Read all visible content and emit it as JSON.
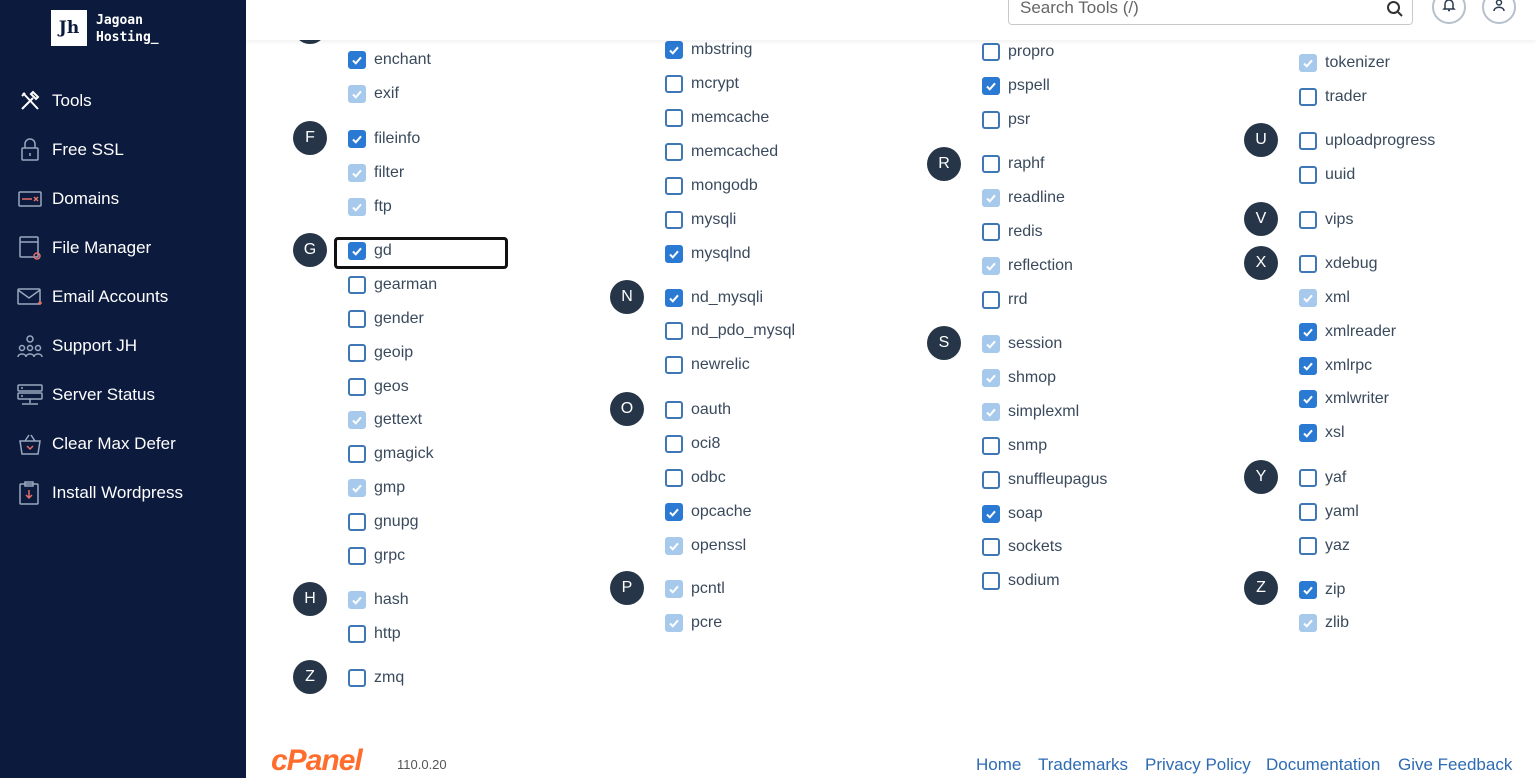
{
  "brand": {
    "logo_text": "Jh",
    "name_line1": "Jagoan",
    "name_line2": "Hosting_"
  },
  "sidebar": {
    "items": [
      {
        "label": "Tools",
        "icon": "tools-icon"
      },
      {
        "label": "Free SSL",
        "icon": "lock-icon"
      },
      {
        "label": "Domains",
        "icon": "domain-icon"
      },
      {
        "label": "File Manager",
        "icon": "file-manager-icon"
      },
      {
        "label": "Email Accounts",
        "icon": "email-icon"
      },
      {
        "label": "Support JH",
        "icon": "support-icon"
      },
      {
        "label": "Server Status",
        "icon": "server-icon"
      },
      {
        "label": "Clear Max Defer",
        "icon": "basket-icon"
      },
      {
        "label": "Install Wordpress",
        "icon": "install-icon"
      }
    ]
  },
  "search": {
    "placeholder": "Search Tools (/)"
  },
  "header_icons": [
    "bell-icon",
    "user-icon"
  ],
  "groups": [
    {
      "letter": "F"
    },
    {
      "letter": "G"
    },
    {
      "letter": "H"
    },
    {
      "letter": "Z"
    },
    {
      "letter": "N"
    },
    {
      "letter": "O"
    },
    {
      "letter": "P"
    },
    {
      "letter": "R"
    },
    {
      "letter": "S"
    },
    {
      "letter": "U"
    },
    {
      "letter": "V"
    },
    {
      "letter": "X"
    },
    {
      "letter": "Y"
    },
    {
      "letter": "Z"
    }
  ],
  "extensions": {
    "col1": [
      {
        "name": "enchant",
        "state": "checked"
      },
      {
        "name": "exif",
        "state": "disabled"
      },
      {
        "name": "fileinfo",
        "state": "checked"
      },
      {
        "name": "filter",
        "state": "disabled"
      },
      {
        "name": "ftp",
        "state": "disabled"
      },
      {
        "name": "gd",
        "state": "checked"
      },
      {
        "name": "gearman",
        "state": "unchecked"
      },
      {
        "name": "gender",
        "state": "unchecked"
      },
      {
        "name": "geoip",
        "state": "unchecked"
      },
      {
        "name": "geos",
        "state": "unchecked"
      },
      {
        "name": "gettext",
        "state": "disabled"
      },
      {
        "name": "gmagick",
        "state": "unchecked"
      },
      {
        "name": "gmp",
        "state": "disabled"
      },
      {
        "name": "gnupg",
        "state": "unchecked"
      },
      {
        "name": "grpc",
        "state": "unchecked"
      },
      {
        "name": "hash",
        "state": "disabled"
      },
      {
        "name": "http",
        "state": "unchecked"
      },
      {
        "name": "zmq",
        "state": "unchecked"
      }
    ],
    "col2": [
      {
        "name": "mbstring",
        "state": "checked"
      },
      {
        "name": "mcrypt",
        "state": "unchecked"
      },
      {
        "name": "memcache",
        "state": "unchecked"
      },
      {
        "name": "memcached",
        "state": "unchecked"
      },
      {
        "name": "mongodb",
        "state": "unchecked"
      },
      {
        "name": "mysqli",
        "state": "unchecked"
      },
      {
        "name": "mysqlnd",
        "state": "checked"
      },
      {
        "name": "nd_mysqli",
        "state": "checked"
      },
      {
        "name": "nd_pdo_mysql",
        "state": "unchecked"
      },
      {
        "name": "newrelic",
        "state": "unchecked"
      },
      {
        "name": "oauth",
        "state": "unchecked"
      },
      {
        "name": "oci8",
        "state": "unchecked"
      },
      {
        "name": "odbc",
        "state": "unchecked"
      },
      {
        "name": "opcache",
        "state": "checked"
      },
      {
        "name": "openssl",
        "state": "disabled"
      },
      {
        "name": "pcntl",
        "state": "disabled"
      },
      {
        "name": "pcre",
        "state": "disabled"
      }
    ],
    "col3": [
      {
        "name": "propro",
        "state": "unchecked"
      },
      {
        "name": "pspell",
        "state": "checked"
      },
      {
        "name": "psr",
        "state": "unchecked"
      },
      {
        "name": "raphf",
        "state": "unchecked"
      },
      {
        "name": "readline",
        "state": "disabled"
      },
      {
        "name": "redis",
        "state": "unchecked"
      },
      {
        "name": "reflection",
        "state": "disabled"
      },
      {
        "name": "rrd",
        "state": "unchecked"
      },
      {
        "name": "session",
        "state": "disabled"
      },
      {
        "name": "shmop",
        "state": "disabled"
      },
      {
        "name": "simplexml",
        "state": "disabled"
      },
      {
        "name": "snmp",
        "state": "unchecked"
      },
      {
        "name": "snuffleupagus",
        "state": "unchecked"
      },
      {
        "name": "soap",
        "state": "checked"
      },
      {
        "name": "sockets",
        "state": "unchecked"
      },
      {
        "name": "sodium",
        "state": "unchecked"
      }
    ],
    "col4": [
      {
        "name": "tokenizer",
        "state": "disabled"
      },
      {
        "name": "trader",
        "state": "unchecked"
      },
      {
        "name": "uploadprogress",
        "state": "unchecked"
      },
      {
        "name": "uuid",
        "state": "unchecked"
      },
      {
        "name": "vips",
        "state": "unchecked"
      },
      {
        "name": "xdebug",
        "state": "unchecked"
      },
      {
        "name": "xml",
        "state": "disabled"
      },
      {
        "name": "xmlreader",
        "state": "checked"
      },
      {
        "name": "xmlrpc",
        "state": "checked"
      },
      {
        "name": "xmlwriter",
        "state": "checked"
      },
      {
        "name": "xsl",
        "state": "checked"
      },
      {
        "name": "yaf",
        "state": "unchecked"
      },
      {
        "name": "yaml",
        "state": "unchecked"
      },
      {
        "name": "yaz",
        "state": "unchecked"
      },
      {
        "name": "zip",
        "state": "checked"
      },
      {
        "name": "zlib",
        "state": "disabled"
      }
    ]
  },
  "footer": {
    "logo": "cPanel",
    "version": "110.0.20",
    "links": [
      "Home",
      "Trademarks",
      "Privacy Policy",
      "Documentation",
      "Give Feedback"
    ]
  },
  "colors": {
    "sidebar_bg": "#0c1a3d",
    "checkbox_checked": "#2a7ad4",
    "checkbox_disabled": "#a6c9ec",
    "cpanel_orange": "#ff6c2c",
    "link": "#2e6bb3"
  }
}
